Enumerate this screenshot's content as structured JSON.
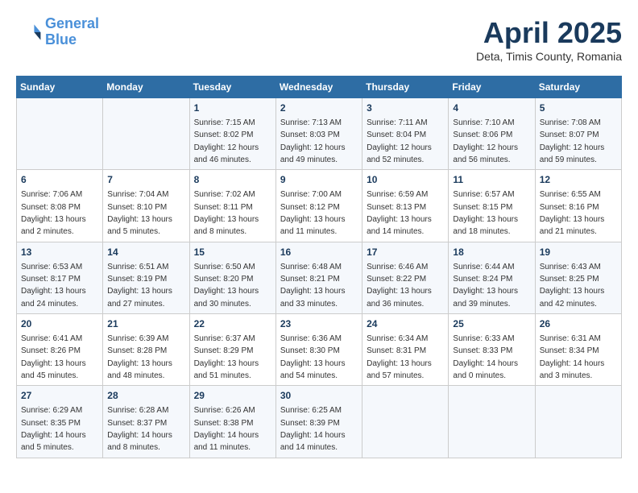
{
  "header": {
    "logo_line1": "General",
    "logo_line2": "Blue",
    "month_title": "April 2025",
    "subtitle": "Deta, Timis County, Romania"
  },
  "weekdays": [
    "Sunday",
    "Monday",
    "Tuesday",
    "Wednesday",
    "Thursday",
    "Friday",
    "Saturday"
  ],
  "weeks": [
    [
      {
        "day": "",
        "sunrise": "",
        "sunset": "",
        "daylight": ""
      },
      {
        "day": "",
        "sunrise": "",
        "sunset": "",
        "daylight": ""
      },
      {
        "day": "1",
        "sunrise": "Sunrise: 7:15 AM",
        "sunset": "Sunset: 8:02 PM",
        "daylight": "Daylight: 12 hours and 46 minutes."
      },
      {
        "day": "2",
        "sunrise": "Sunrise: 7:13 AM",
        "sunset": "Sunset: 8:03 PM",
        "daylight": "Daylight: 12 hours and 49 minutes."
      },
      {
        "day": "3",
        "sunrise": "Sunrise: 7:11 AM",
        "sunset": "Sunset: 8:04 PM",
        "daylight": "Daylight: 12 hours and 52 minutes."
      },
      {
        "day": "4",
        "sunrise": "Sunrise: 7:10 AM",
        "sunset": "Sunset: 8:06 PM",
        "daylight": "Daylight: 12 hours and 56 minutes."
      },
      {
        "day": "5",
        "sunrise": "Sunrise: 7:08 AM",
        "sunset": "Sunset: 8:07 PM",
        "daylight": "Daylight: 12 hours and 59 minutes."
      }
    ],
    [
      {
        "day": "6",
        "sunrise": "Sunrise: 7:06 AM",
        "sunset": "Sunset: 8:08 PM",
        "daylight": "Daylight: 13 hours and 2 minutes."
      },
      {
        "day": "7",
        "sunrise": "Sunrise: 7:04 AM",
        "sunset": "Sunset: 8:10 PM",
        "daylight": "Daylight: 13 hours and 5 minutes."
      },
      {
        "day": "8",
        "sunrise": "Sunrise: 7:02 AM",
        "sunset": "Sunset: 8:11 PM",
        "daylight": "Daylight: 13 hours and 8 minutes."
      },
      {
        "day": "9",
        "sunrise": "Sunrise: 7:00 AM",
        "sunset": "Sunset: 8:12 PM",
        "daylight": "Daylight: 13 hours and 11 minutes."
      },
      {
        "day": "10",
        "sunrise": "Sunrise: 6:59 AM",
        "sunset": "Sunset: 8:13 PM",
        "daylight": "Daylight: 13 hours and 14 minutes."
      },
      {
        "day": "11",
        "sunrise": "Sunrise: 6:57 AM",
        "sunset": "Sunset: 8:15 PM",
        "daylight": "Daylight: 13 hours and 18 minutes."
      },
      {
        "day": "12",
        "sunrise": "Sunrise: 6:55 AM",
        "sunset": "Sunset: 8:16 PM",
        "daylight": "Daylight: 13 hours and 21 minutes."
      }
    ],
    [
      {
        "day": "13",
        "sunrise": "Sunrise: 6:53 AM",
        "sunset": "Sunset: 8:17 PM",
        "daylight": "Daylight: 13 hours and 24 minutes."
      },
      {
        "day": "14",
        "sunrise": "Sunrise: 6:51 AM",
        "sunset": "Sunset: 8:19 PM",
        "daylight": "Daylight: 13 hours and 27 minutes."
      },
      {
        "day": "15",
        "sunrise": "Sunrise: 6:50 AM",
        "sunset": "Sunset: 8:20 PM",
        "daylight": "Daylight: 13 hours and 30 minutes."
      },
      {
        "day": "16",
        "sunrise": "Sunrise: 6:48 AM",
        "sunset": "Sunset: 8:21 PM",
        "daylight": "Daylight: 13 hours and 33 minutes."
      },
      {
        "day": "17",
        "sunrise": "Sunrise: 6:46 AM",
        "sunset": "Sunset: 8:22 PM",
        "daylight": "Daylight: 13 hours and 36 minutes."
      },
      {
        "day": "18",
        "sunrise": "Sunrise: 6:44 AM",
        "sunset": "Sunset: 8:24 PM",
        "daylight": "Daylight: 13 hours and 39 minutes."
      },
      {
        "day": "19",
        "sunrise": "Sunrise: 6:43 AM",
        "sunset": "Sunset: 8:25 PM",
        "daylight": "Daylight: 13 hours and 42 minutes."
      }
    ],
    [
      {
        "day": "20",
        "sunrise": "Sunrise: 6:41 AM",
        "sunset": "Sunset: 8:26 PM",
        "daylight": "Daylight: 13 hours and 45 minutes."
      },
      {
        "day": "21",
        "sunrise": "Sunrise: 6:39 AM",
        "sunset": "Sunset: 8:28 PM",
        "daylight": "Daylight: 13 hours and 48 minutes."
      },
      {
        "day": "22",
        "sunrise": "Sunrise: 6:37 AM",
        "sunset": "Sunset: 8:29 PM",
        "daylight": "Daylight: 13 hours and 51 minutes."
      },
      {
        "day": "23",
        "sunrise": "Sunrise: 6:36 AM",
        "sunset": "Sunset: 8:30 PM",
        "daylight": "Daylight: 13 hours and 54 minutes."
      },
      {
        "day": "24",
        "sunrise": "Sunrise: 6:34 AM",
        "sunset": "Sunset: 8:31 PM",
        "daylight": "Daylight: 13 hours and 57 minutes."
      },
      {
        "day": "25",
        "sunrise": "Sunrise: 6:33 AM",
        "sunset": "Sunset: 8:33 PM",
        "daylight": "Daylight: 14 hours and 0 minutes."
      },
      {
        "day": "26",
        "sunrise": "Sunrise: 6:31 AM",
        "sunset": "Sunset: 8:34 PM",
        "daylight": "Daylight: 14 hours and 3 minutes."
      }
    ],
    [
      {
        "day": "27",
        "sunrise": "Sunrise: 6:29 AM",
        "sunset": "Sunset: 8:35 PM",
        "daylight": "Daylight: 14 hours and 5 minutes."
      },
      {
        "day": "28",
        "sunrise": "Sunrise: 6:28 AM",
        "sunset": "Sunset: 8:37 PM",
        "daylight": "Daylight: 14 hours and 8 minutes."
      },
      {
        "day": "29",
        "sunrise": "Sunrise: 6:26 AM",
        "sunset": "Sunset: 8:38 PM",
        "daylight": "Daylight: 14 hours and 11 minutes."
      },
      {
        "day": "30",
        "sunrise": "Sunrise: 6:25 AM",
        "sunset": "Sunset: 8:39 PM",
        "daylight": "Daylight: 14 hours and 14 minutes."
      },
      {
        "day": "",
        "sunrise": "",
        "sunset": "",
        "daylight": ""
      },
      {
        "day": "",
        "sunrise": "",
        "sunset": "",
        "daylight": ""
      },
      {
        "day": "",
        "sunrise": "",
        "sunset": "",
        "daylight": ""
      }
    ]
  ]
}
